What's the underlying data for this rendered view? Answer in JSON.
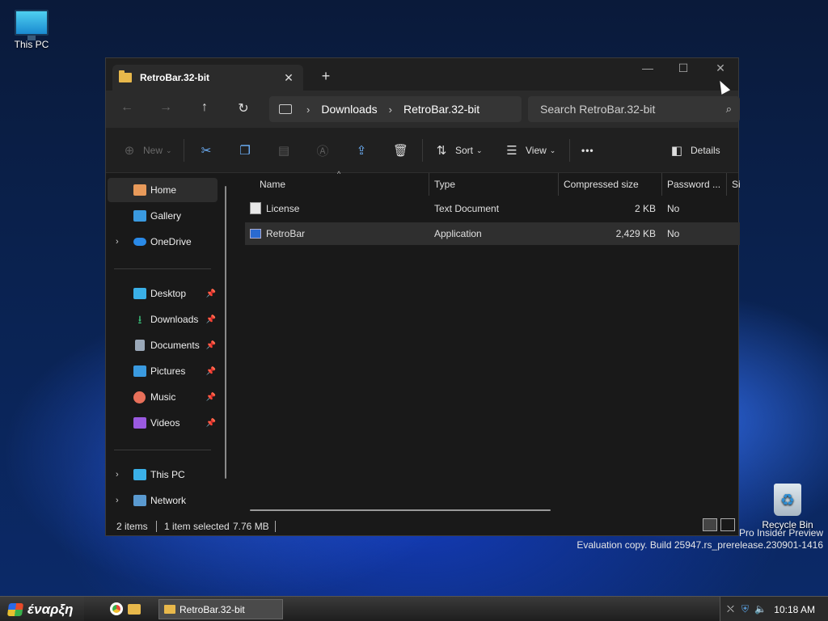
{
  "desktop": {
    "icons": [
      {
        "label": "This PC",
        "icon": "monitor-icon"
      },
      {
        "label": "Recycle Bin",
        "icon": "recycle-bin-icon"
      }
    ],
    "watermark": {
      "line1": "Pro Insider Preview",
      "line2": "Evaluation copy. Build 25947.rs_prerelease.230901-1416"
    }
  },
  "window": {
    "tab_title": "RetroBar.32-bit",
    "new_tab": "+",
    "controls": {
      "minimize": "—",
      "maximize": "☐",
      "close": "✕"
    },
    "address": {
      "breadcrumbs": [
        "Downloads",
        "RetroBar.32-bit"
      ],
      "search_placeholder": "Search RetroBar.32-bit"
    },
    "commands": {
      "new": "New",
      "sort": "Sort",
      "view": "View",
      "more": "•••",
      "details": "Details"
    },
    "sidebar": {
      "top": [
        {
          "label": "Home",
          "icon": "home-icon",
          "selected": true
        },
        {
          "label": "Gallery",
          "icon": "gallery-icon"
        },
        {
          "label": "OneDrive",
          "icon": "cloud-icon",
          "expandable": true
        }
      ],
      "quick": [
        {
          "label": "Desktop",
          "icon": "desktop-icon"
        },
        {
          "label": "Downloads",
          "icon": "download-icon"
        },
        {
          "label": "Documents",
          "icon": "documents-icon"
        },
        {
          "label": "Pictures",
          "icon": "pictures-icon"
        },
        {
          "label": "Music",
          "icon": "music-icon"
        },
        {
          "label": "Videos",
          "icon": "videos-icon"
        }
      ],
      "bottom": [
        {
          "label": "This PC",
          "icon": "pc-icon",
          "expandable": true
        },
        {
          "label": "Network",
          "icon": "network-icon",
          "expandable": true
        }
      ]
    },
    "columns": [
      "Name",
      "Type",
      "Compressed size",
      "Password ...",
      "Si"
    ],
    "files": [
      {
        "name": "License",
        "type": "Text Document",
        "size": "2 KB",
        "password": "No",
        "icon": "text-file-icon"
      },
      {
        "name": "RetroBar",
        "type": "Application",
        "size": "2,429 KB",
        "password": "No",
        "icon": "application-icon",
        "selected": true
      }
    ],
    "status": {
      "items": "2 items",
      "selected": "1 item selected",
      "size": "7.76 MB"
    }
  },
  "taskbar": {
    "start_label": "έναρξη",
    "task_title": "RetroBar.32-bit",
    "clock": "10:18 AM"
  },
  "colors": {
    "accent": "#6fb4ff",
    "window_bg": "#191919",
    "folder": "#e8b84b"
  }
}
